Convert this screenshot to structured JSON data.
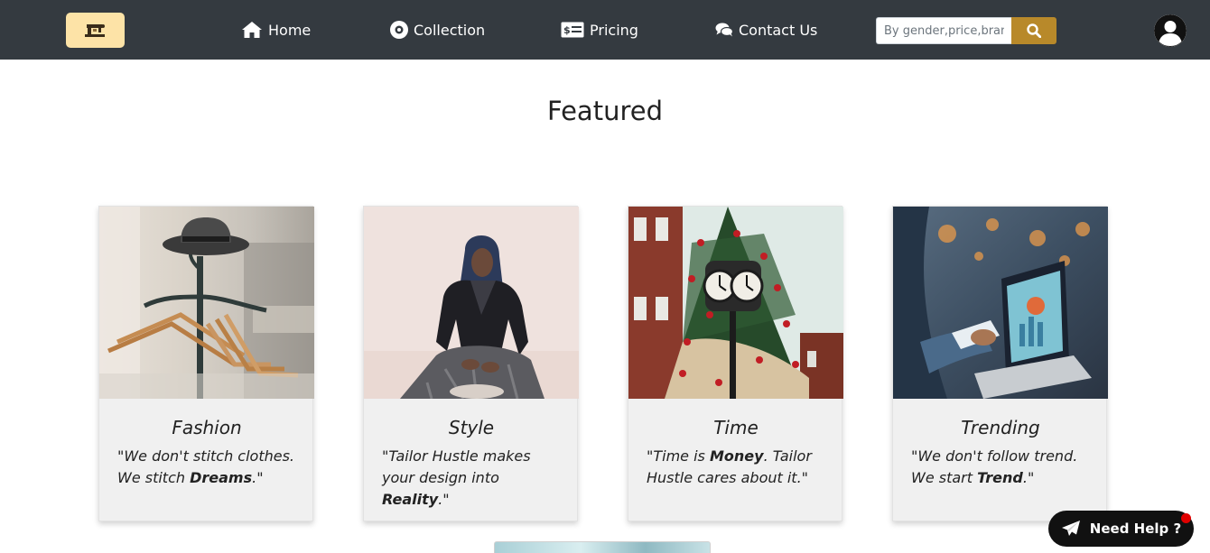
{
  "navbar": {
    "home_label": "Home",
    "collection_label": "Collection",
    "pricing_label": "Pricing",
    "contact_label": "Contact Us",
    "search_placeholder": "By gender,price,brand",
    "colors": {
      "background": "#343a40",
      "logo_bg": "#fde3a7",
      "search_button": "#b8892a"
    }
  },
  "section": {
    "heading": "Featured"
  },
  "cards": [
    {
      "title": "Fashion",
      "quote_pre": "\"We don't stitch clothes. We stitch ",
      "quote_bold": "Dreams",
      "quote_post": ".\"",
      "image": "clothes-rack-with-hat-image"
    },
    {
      "title": "Style",
      "quote_pre": "\"Tailor Hustle makes your design into ",
      "quote_bold": "Reality",
      "quote_post": ".\"",
      "image": "woman-in-leather-jacket-image"
    },
    {
      "title": "Time",
      "quote_pre": "\"Time is ",
      "quote_bold": "Money",
      "quote_post": ". Tailor Hustle cares about it.\"",
      "image": "clock-christmas-tree-image"
    },
    {
      "title": "Trending",
      "quote_pre": "\"We don't follow trend. We start ",
      "quote_bold": "Trend",
      "quote_post": ".\"",
      "image": "phone-laptop-image"
    }
  ],
  "help": {
    "label": "Need Help ?",
    "dot_color": "#e00000"
  }
}
